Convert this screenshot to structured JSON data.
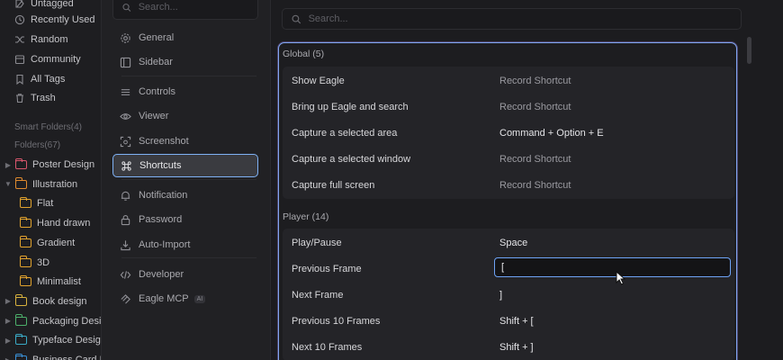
{
  "library": {
    "quick": [
      {
        "label": "Untagged",
        "icon": "untagged-icon"
      },
      {
        "label": "Recently Used",
        "icon": "clock-icon"
      },
      {
        "label": "Random",
        "icon": "shuffle-icon"
      },
      {
        "label": "Community",
        "icon": "community-icon"
      },
      {
        "label": "All Tags",
        "icon": "tag-icon"
      },
      {
        "label": "Trash",
        "icon": "trash-icon"
      }
    ],
    "smart_folders": "Smart Folders(4)",
    "folders_label": "Folders(67)",
    "folders": [
      {
        "label": "Poster Design",
        "color": "#d8566c",
        "level": 0,
        "caret": "right"
      },
      {
        "label": "Illustration",
        "color": "#e08a2e",
        "level": 0,
        "caret": "down"
      },
      {
        "label": "Flat",
        "color": "#e0a22e",
        "level": 1,
        "caret": ""
      },
      {
        "label": "Hand drawn",
        "color": "#e0a22e",
        "level": 1,
        "caret": ""
      },
      {
        "label": "Gradient",
        "color": "#e0a22e",
        "level": 1,
        "caret": ""
      },
      {
        "label": "3D",
        "color": "#e0a22e",
        "level": 1,
        "caret": ""
      },
      {
        "label": "Minimalist",
        "color": "#e0a22e",
        "level": 1,
        "caret": ""
      },
      {
        "label": "Book design",
        "color": "#d8b23e",
        "level": 0,
        "caret": "right"
      },
      {
        "label": "Packaging Design",
        "color": "#4caf6a",
        "level": 0,
        "caret": "right"
      },
      {
        "label": "Typeface Design",
        "color": "#3aa9c4",
        "level": 0,
        "caret": "right"
      },
      {
        "label": "Business Card Design",
        "color": "#3a8fd4",
        "level": 0,
        "caret": "right"
      }
    ]
  },
  "prefnav": {
    "search_placeholder": "Search...",
    "items": [
      {
        "label": "General",
        "icon": "gear-icon"
      },
      {
        "label": "Sidebar",
        "icon": "sidebar-icon"
      },
      {
        "label": "Controls",
        "icon": "controls-icon"
      },
      {
        "label": "Viewer",
        "icon": "eye-icon"
      },
      {
        "label": "Screenshot",
        "icon": "screenshot-icon"
      },
      {
        "label": "Shortcuts",
        "icon": "command-icon",
        "active": true
      },
      {
        "label": "Notification",
        "icon": "bell-icon"
      },
      {
        "label": "Password",
        "icon": "lock-icon"
      },
      {
        "label": "Auto-Import",
        "icon": "import-icon"
      },
      {
        "label": "Developer",
        "icon": "code-icon"
      },
      {
        "label": "Eagle MCP",
        "icon": "mcp-icon",
        "badge": "AI"
      }
    ]
  },
  "main": {
    "search_placeholder": "Search...",
    "groups": [
      {
        "title": "Global (5)",
        "rows": [
          {
            "name": "Show Eagle",
            "value": "Record Shortcut",
            "set": false
          },
          {
            "name": "Bring up Eagle and search",
            "value": "Record Shortcut",
            "set": false
          },
          {
            "name": "Capture a selected area",
            "value": "Command + Option + E",
            "set": true
          },
          {
            "name": "Capture a selected window",
            "value": "Record Shortcut",
            "set": false
          },
          {
            "name": "Capture full screen",
            "value": "Record Shortcut",
            "set": false
          }
        ]
      },
      {
        "title": "Player (14)",
        "rows": [
          {
            "name": "Play/Pause",
            "value": "Space",
            "set": true
          },
          {
            "name": "Previous Frame",
            "value": "[",
            "set": true,
            "editing": true
          },
          {
            "name": "Next Frame",
            "value": "]",
            "set": true
          },
          {
            "name": "Previous 10 Frames",
            "value": "Shift + [",
            "set": true
          },
          {
            "name": "Next 10 Frames",
            "value": "Shift + ]",
            "set": true
          }
        ]
      }
    ]
  }
}
